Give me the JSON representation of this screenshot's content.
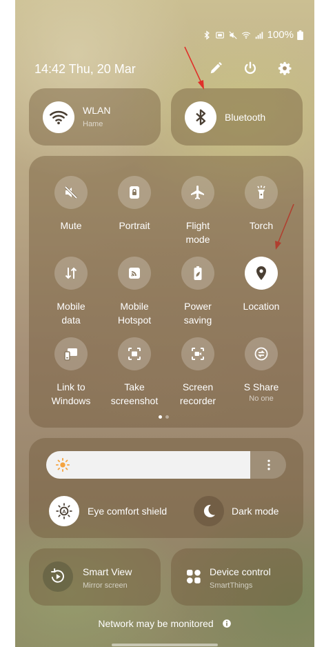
{
  "status_bar": {
    "battery": "100%"
  },
  "header": {
    "datetime": "14:42  Thu, 20 Mar"
  },
  "wlan": {
    "label": "WLAN",
    "sub": "Hame"
  },
  "bluetooth": {
    "label": "Bluetooth"
  },
  "tiles": [
    {
      "label": "Mute",
      "sub": ""
    },
    {
      "label": "Portrait",
      "sub": ""
    },
    {
      "label": "Flight\nmode",
      "sub": ""
    },
    {
      "label": "Torch",
      "sub": ""
    },
    {
      "label": "Mobile\ndata",
      "sub": ""
    },
    {
      "label": "Mobile\nHotspot",
      "sub": ""
    },
    {
      "label": "Power\nsaving",
      "sub": ""
    },
    {
      "label": "Location",
      "sub": ""
    },
    {
      "label": "Link to\nWindows",
      "sub": ""
    },
    {
      "label": "Take\nscreenshot",
      "sub": ""
    },
    {
      "label": "Screen\nrecorder",
      "sub": ""
    },
    {
      "label": "S Share",
      "sub": "No one"
    }
  ],
  "display": {
    "eye_comfort": "Eye comfort shield",
    "dark_mode": "Dark mode"
  },
  "bottom": {
    "smart_view": {
      "label": "Smart View",
      "sub": "Mirror screen"
    },
    "device_control": {
      "label": "Device control",
      "sub": "SmartThings"
    }
  },
  "footer": {
    "text": "Network may be monitored"
  },
  "brightness": {
    "level": 0.85
  },
  "pager": {
    "pages": 2,
    "current": 1
  },
  "colors": {
    "accent": "#ffffff",
    "brightness_sun": "#f4a340"
  }
}
